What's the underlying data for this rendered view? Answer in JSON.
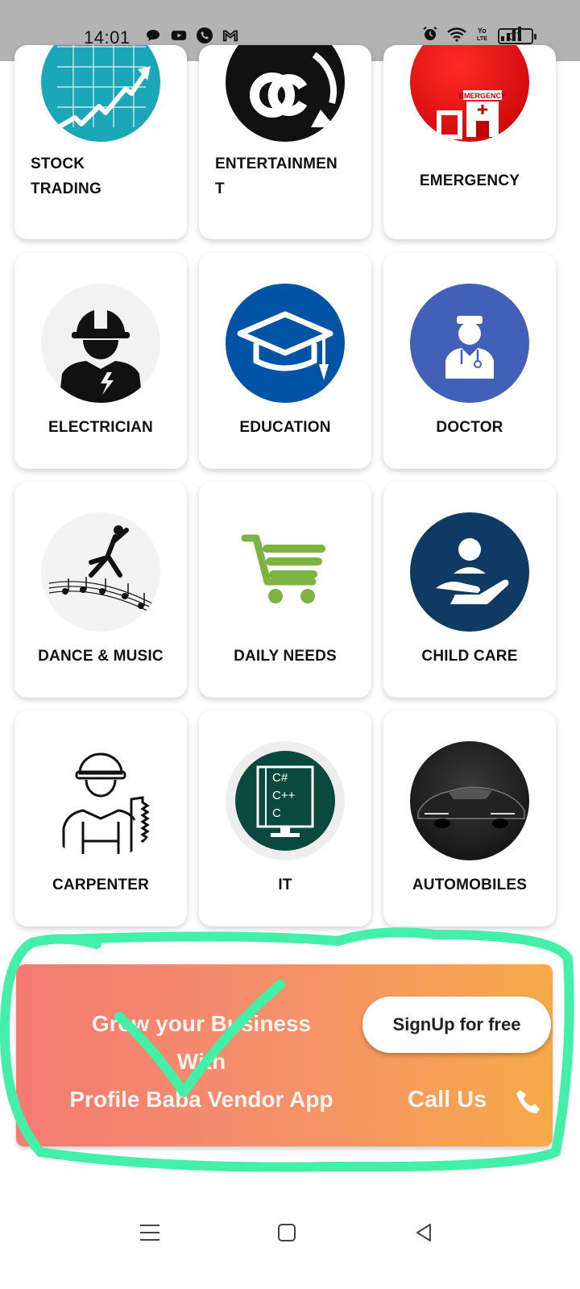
{
  "status_bar": {
    "time": "14:01",
    "battery": "37",
    "left_icons": [
      "chat-icon",
      "youtube-icon",
      "phone-icon",
      "gmail-icon"
    ],
    "right_icons": [
      "alarm-icon",
      "wifi-icon",
      "volte-icon",
      "signal-icon"
    ]
  },
  "categories": [
    {
      "label": "STOCK\nTRADING",
      "icon": "stock-trading-icon"
    },
    {
      "label": "ENTERTAINMEN\nT",
      "icon": "entertainment-icon"
    },
    {
      "label": "EMERGENCY",
      "icon": "emergency-icon",
      "badge": "EMERGENCY"
    },
    {
      "label": "ELECTRICIAN",
      "icon": "electrician-icon"
    },
    {
      "label": "EDUCATION",
      "icon": "education-icon"
    },
    {
      "label": "DOCTOR",
      "icon": "doctor-icon"
    },
    {
      "label": "DANCE & MUSIC",
      "icon": "dance-music-icon"
    },
    {
      "label": "DAILY NEEDS",
      "icon": "shopping-cart-icon"
    },
    {
      "label": "CHILD CARE",
      "icon": "child-care-icon"
    },
    {
      "label": "CARPENTER",
      "icon": "carpenter-icon"
    },
    {
      "label": "IT",
      "icon": "it-icon",
      "code_lines": [
        "C#",
        "C++",
        "C"
      ]
    },
    {
      "label": "AUTOMOBILES",
      "icon": "car-icon"
    }
  ],
  "promo": {
    "line1": "Grow your Business",
    "line2": "With",
    "line3": "Profile Baba Vendor App",
    "signup_label": "SignUp for free",
    "call_label": "Call Us"
  },
  "colors": {
    "promo_start": "#f47a72",
    "promo_end": "#f6aa48",
    "annotation": "#44f0a8"
  },
  "nav": {
    "icons": [
      "menu-icon",
      "home-icon",
      "back-icon"
    ]
  }
}
